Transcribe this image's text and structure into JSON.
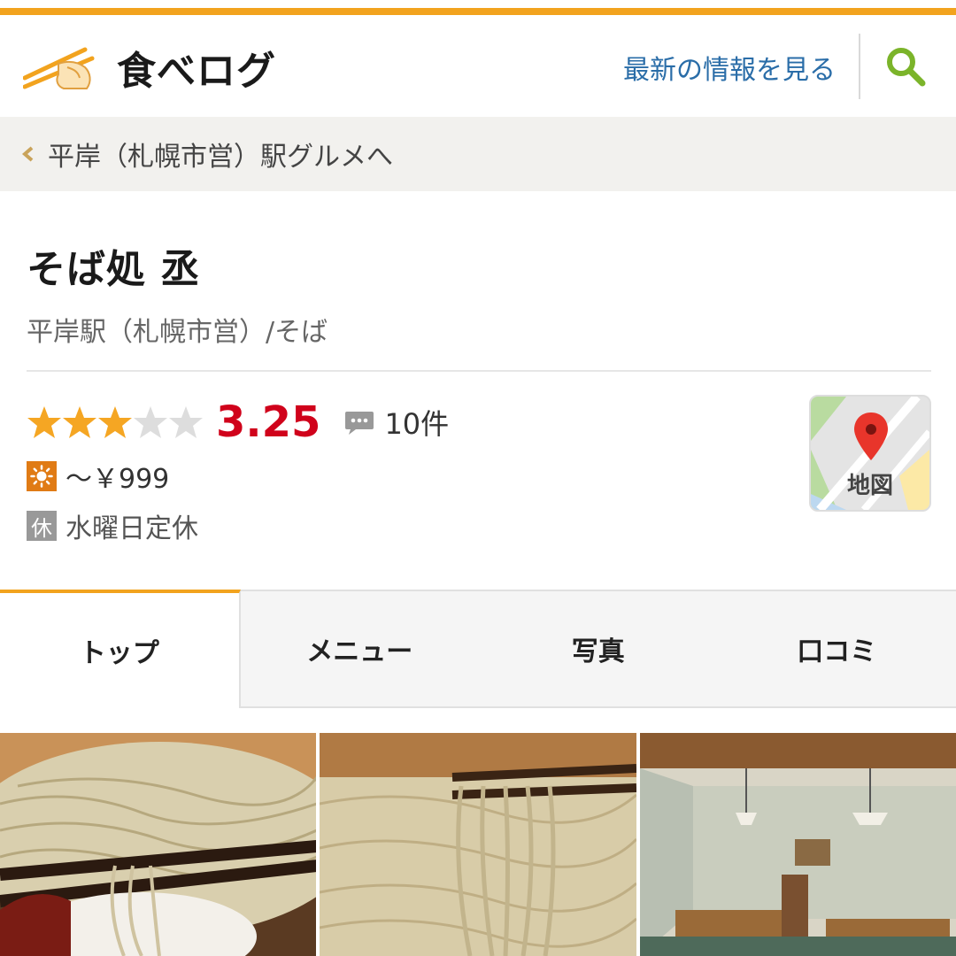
{
  "header": {
    "logo_text": "食べログ",
    "latest_link": "最新の情報を見る"
  },
  "breadcrumb": {
    "text": "平岸（札幌市営）駅グルメへ"
  },
  "shop": {
    "name": "そば処 丞",
    "subtitle": "平岸駅（札幌市営）/そば",
    "rating_stars": 3,
    "rating_max": 5,
    "score": "3.25",
    "review_count": "10件",
    "price": "～￥999",
    "holiday_badge": "休",
    "holiday_text": "水曜日定休",
    "map_label": "地図"
  },
  "tabs": [
    {
      "label": "トップ",
      "active": true
    },
    {
      "label": "メニュー",
      "active": false
    },
    {
      "label": "写真",
      "active": false
    },
    {
      "label": "口コミ",
      "active": false
    }
  ],
  "colors": {
    "accent": "#f2a31e",
    "score": "#d0021b",
    "link": "#2a6da8",
    "star_on": "#f5a623",
    "star_off": "#dddddd"
  },
  "icons": [
    "chopsticks-logo-icon",
    "search-icon",
    "chevron-left-icon",
    "star-icon",
    "speech-bubble-icon",
    "sun-icon",
    "map-pin-icon"
  ]
}
